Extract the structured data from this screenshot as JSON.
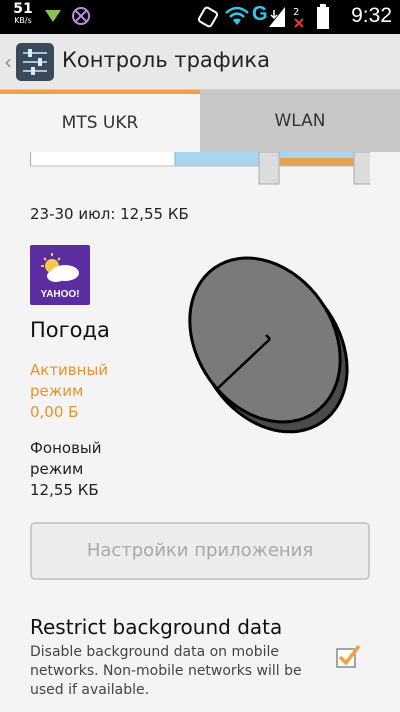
{
  "status_bar": {
    "speed_value": "51",
    "speed_unit": "KB/s",
    "network_letter": "G",
    "time": "9:32",
    "icons": [
      "download-arrow-icon",
      "android-icon",
      "sync-icon",
      "wifi-icon",
      "signal-icon",
      "no-signal-icon",
      "battery-icon"
    ]
  },
  "action_bar": {
    "title": "Контроль трафика"
  },
  "tabs": [
    {
      "label": "MTS UKR",
      "active": true
    },
    {
      "label": "WLAN",
      "active": false
    }
  ],
  "period": "23-30 июл: 12,55 КБ",
  "app": {
    "icon_text": "YAHOO!",
    "name": "Погода",
    "foreground_label": "Активный режим",
    "foreground_value": "0,00 Б",
    "background_label": "Фоновый режим",
    "background_value": "12,55 КБ"
  },
  "settings_button": "Настройки приложения",
  "restrict": {
    "title": "Restrict background data",
    "description": "Disable background data on mobile networks. Non-mobile networks will be used if available.",
    "checked": true
  },
  "colors": {
    "accent": "#f1a045",
    "yahoo_purple": "#5b2da0",
    "foreground_text": "#e8922a"
  }
}
